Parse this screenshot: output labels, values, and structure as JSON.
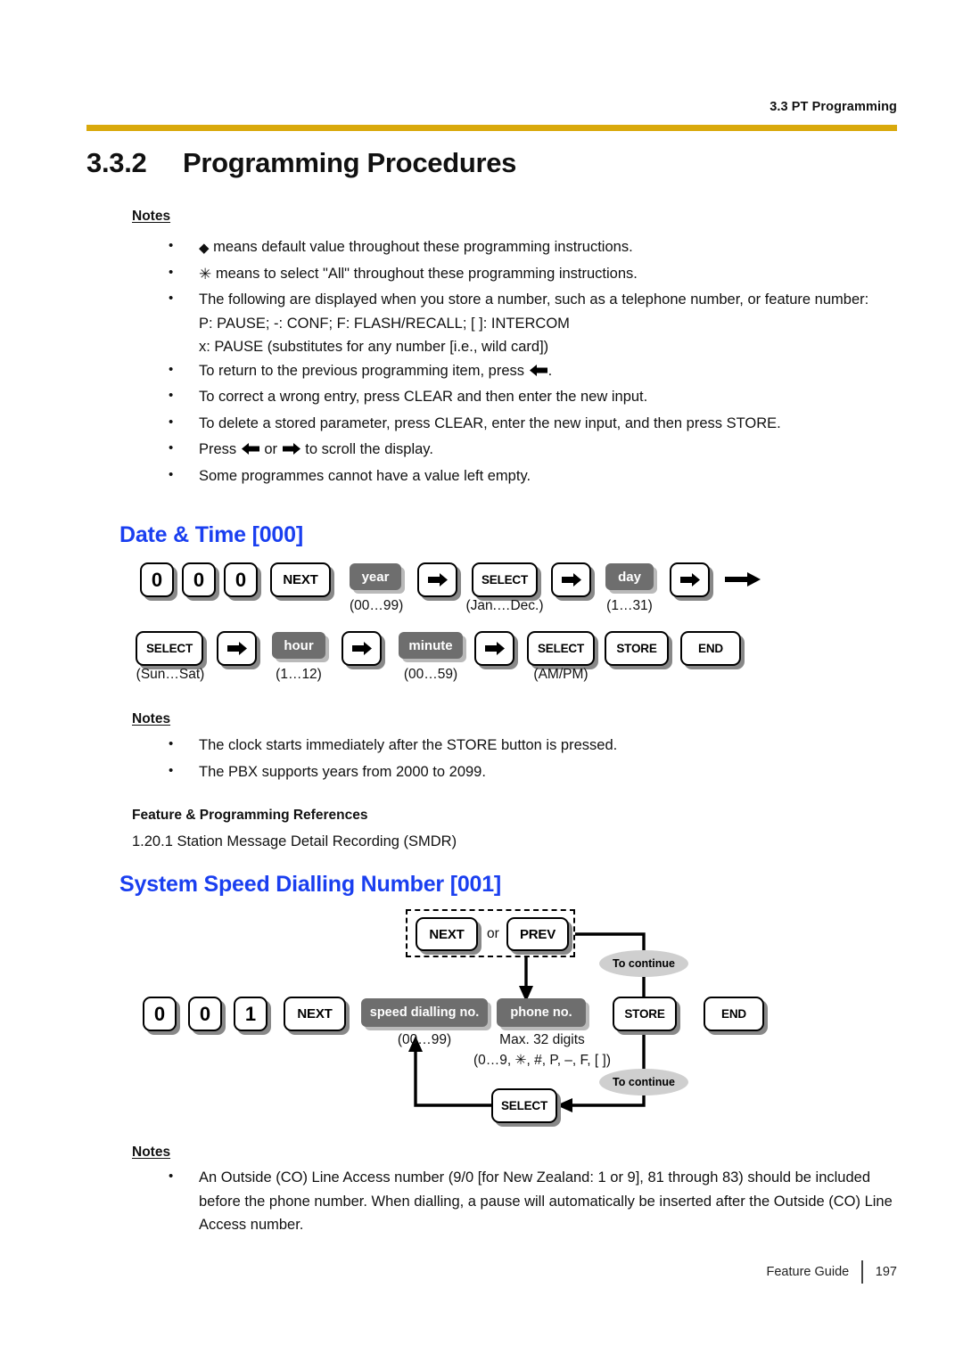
{
  "header": {
    "running_head": "3.3 PT Programming",
    "rule_color": "#d9a90c"
  },
  "section": {
    "number": "3.3.2",
    "title": "Programming Procedures"
  },
  "intro_notes": {
    "heading": "Notes",
    "items": [
      "means default value throughout these programming instructions.",
      "means to select \"All\" throughout these programming instructions.",
      "The following are displayed when you store a number, such as a telephone number, or feature number:",
      "To return to the previous programming item, press",
      "To correct a wrong entry, press CLEAR and then enter the new input.",
      "To delete a stored parameter, press CLEAR, enter the new input, and then press STORE.",
      "Press",
      "Some programmes cannot have a value left empty."
    ],
    "display_line_1": "P: PAUSE; -: CONF; F: FLASH/RECALL; [ ]: INTERCOM",
    "display_line_2": "x: PAUSE (substitutes for any number [i.e., wild card])",
    "press_or": "or",
    "press_tail": "to scroll the display.",
    "period": "."
  },
  "programmes": [
    {
      "heading": "Date & Time [000]",
      "heading_color": "#1a3ff0",
      "rows": [
        {
          "keys": [
            {
              "label": "0",
              "type": "digit"
            },
            {
              "label": "0",
              "type": "digit"
            },
            {
              "label": "0",
              "type": "digit"
            },
            {
              "label": "NEXT",
              "type": "key"
            },
            {
              "label": "year",
              "type": "gray",
              "caption": "(00…99)"
            },
            {
              "label": "arrow-right-icon",
              "type": "arrow"
            },
            {
              "label": "SELECT",
              "type": "key",
              "caption": "(Jan.…Dec.)"
            },
            {
              "label": "arrow-right-icon",
              "type": "arrow"
            },
            {
              "label": "day",
              "type": "gray",
              "caption": "(1…31)"
            },
            {
              "label": "arrow-right-icon",
              "type": "arrow"
            },
            {
              "label": "continue-arrow-icon",
              "type": "plainarrow"
            }
          ]
        },
        {
          "keys": [
            {
              "label": "SELECT",
              "type": "key",
              "caption": "(Sun…Sat)"
            },
            {
              "label": "arrow-right-icon",
              "type": "arrow"
            },
            {
              "label": "hour",
              "type": "gray",
              "caption": "(1…12)"
            },
            {
              "label": "arrow-right-icon",
              "type": "arrow"
            },
            {
              "label": "minute",
              "type": "gray",
              "caption": "(00…59)"
            },
            {
              "label": "arrow-right-icon",
              "type": "arrow"
            },
            {
              "label": "SELECT",
              "type": "key",
              "caption": "(AM/PM)"
            },
            {
              "label": "STORE",
              "type": "key"
            },
            {
              "label": "END",
              "type": "key"
            }
          ]
        }
      ],
      "notes": {
        "heading": "Notes",
        "items": [
          "The clock starts immediately after the STORE button is pressed.",
          "The PBX supports years from 2000 to 2099."
        ]
      },
      "references": {
        "heading": "Feature & Programming References",
        "items": [
          "1.20.1 Station Message Detail Recording (SMDR)"
        ]
      }
    },
    {
      "heading": "System Speed Dialling Number [001]",
      "heading_color": "#1a3ff0",
      "loop_group": {
        "keys": [
          "NEXT",
          "PREV"
        ],
        "separator": "or"
      },
      "main_row": {
        "keys": [
          {
            "label": "0",
            "type": "digit"
          },
          {
            "label": "0",
            "type": "digit"
          },
          {
            "label": "1",
            "type": "digit"
          },
          {
            "label": "NEXT",
            "type": "key"
          },
          {
            "label": "speed dialling no.",
            "type": "gray",
            "caption": "(00…99)"
          },
          {
            "label": "phone no.",
            "type": "gray",
            "caption_1": "Max. 32 digits",
            "caption_2": "(0…9, ✳, #, P, –, F, [ ])"
          },
          {
            "label": "STORE",
            "type": "key"
          },
          {
            "label": "END",
            "type": "key"
          }
        ]
      },
      "select_loop_key": "SELECT",
      "continue_labels": [
        "To continue",
        "To continue"
      ],
      "notes": {
        "heading": "Notes",
        "items": [
          "An Outside (CO) Line Access number (9/0 [for New Zealand: 1 or 9], 81 through 83) should be included before the phone number. When dialling, a pause will automatically be inserted after the Outside (CO) Line Access number."
        ]
      }
    }
  ],
  "footer": {
    "guide": "Feature Guide",
    "page": "197"
  }
}
